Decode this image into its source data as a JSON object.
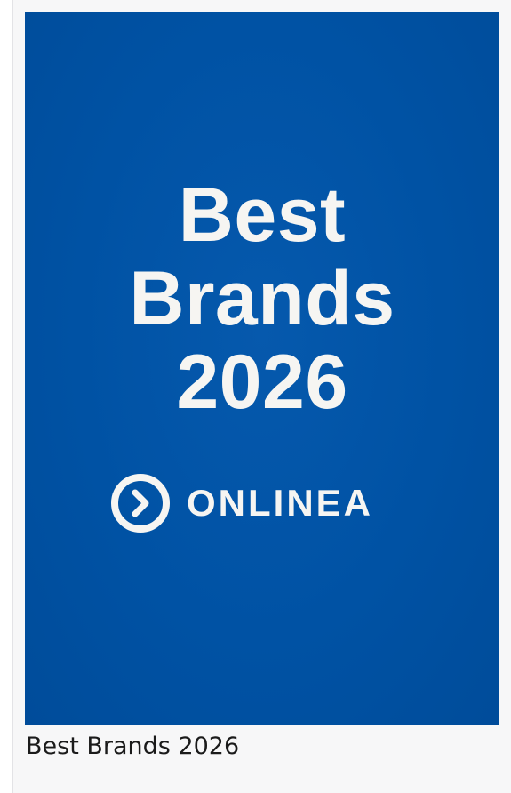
{
  "poster": {
    "headline_lines": [
      "Best",
      "Brands",
      "2026"
    ],
    "logo": {
      "icon": "chevron-right-circle-icon",
      "text": "ONLINEA"
    },
    "background_color": "#0052a4",
    "text_color": "#f6f5f2"
  },
  "caption": "Best Brands 2026"
}
